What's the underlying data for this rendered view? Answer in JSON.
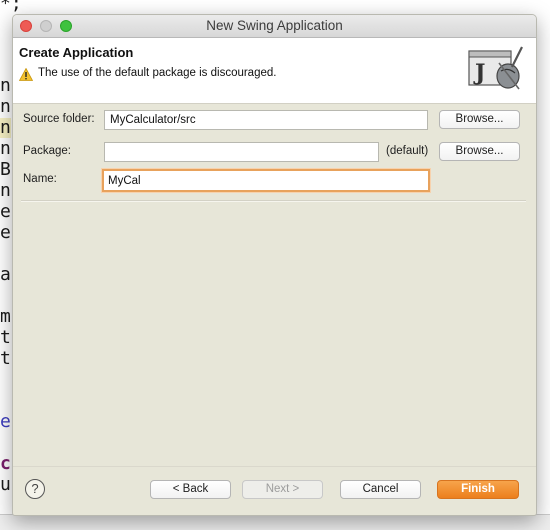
{
  "background_editor": {
    "top_text": "*;",
    "line_chars": [
      "n",
      "n",
      "n",
      "n",
      "B",
      "n",
      "e",
      "e",
      "a",
      "m",
      "t",
      "t",
      "e",
      "c",
      "u"
    ]
  },
  "dialog": {
    "window_title": "New Swing Application",
    "header_title": "Create Application",
    "warning_message": "The use of the default package is discouraged.",
    "banner_icon": "java-swing-wizard-icon",
    "form": {
      "source_folder_label": "Source folder:",
      "source_folder_value": "MyCalculator/src",
      "package_label": "Package:",
      "package_value": "",
      "package_default_hint": "(default)",
      "name_label": "Name:",
      "name_value": "MyCal",
      "browse_label": "Browse..."
    },
    "buttons": {
      "help": "?",
      "back": "< Back",
      "next": "Next >",
      "cancel": "Cancel",
      "finish": "Finish"
    },
    "colors": {
      "dialog_bg": "#e7e6d8",
      "finish_button": "#ec7f1d",
      "focus_ring": "#e8a25c",
      "warning": "#f2c12e"
    }
  }
}
